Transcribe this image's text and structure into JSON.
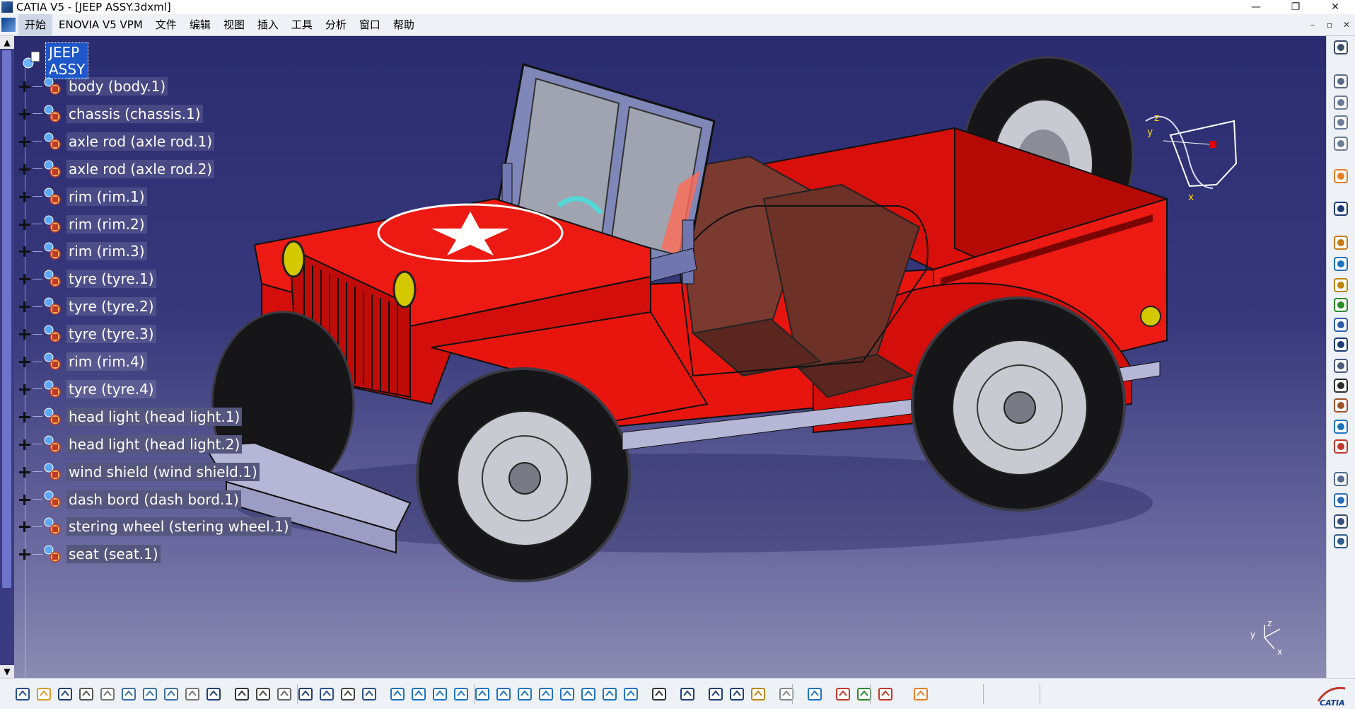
{
  "window": {
    "title": "CATIA V5 - [JEEP ASSY.3dxml]",
    "minimize_glyph": "—",
    "restore_glyph": "❐",
    "close_glyph": "✕"
  },
  "menu": {
    "items": [
      "开始",
      "ENOVIA V5 VPM",
      "文件",
      "编辑",
      "视图",
      "插入",
      "工具",
      "分析",
      "窗口",
      "帮助"
    ],
    "active_index": 0,
    "mdi_min": "–",
    "mdi_restore": "▫",
    "mdi_close": "✕"
  },
  "tree": {
    "root_label": "JEEP ASSY",
    "items": [
      "body (body.1)",
      "chassis (chassis.1)",
      "axle rod (axle rod.1)",
      "axle rod (axle rod.2)",
      "rim (rim.1)",
      "rim (rim.2)",
      "rim (rim.3)",
      "tyre (tyre.1)",
      "tyre (tyre.2)",
      "tyre (tyre.3)",
      "rim (rim.4)",
      "tyre (tyre.4)",
      "head light (head light.1)",
      "head light (head light.2)",
      "wind shield (wind shield.1)",
      "dash bord (dash bord.1)",
      "stering wheel (stering wheel.1)",
      "seat (seat.1)"
    ]
  },
  "compass": {
    "x_label": "x",
    "y_label": "y",
    "z_label": "z"
  },
  "axis_triad": {
    "x_label": "x",
    "y_label": "y",
    "z_label": "z"
  },
  "brand": {
    "logo_text": "CATIA"
  },
  "colors": {
    "viewport_top": "#2b2c70",
    "viewport_bottom": "#8c8bb2",
    "jeep_body": "#e8150f",
    "tyre": "#161618",
    "seat": "#7a3a30",
    "selection": "#1d57c9"
  },
  "icons": {
    "right_toolbar": [
      "multi-view-icon",
      "product-icon",
      "part-icon",
      "catalog-icon",
      "analysis-icon",
      "select-arrow-icon",
      "snap-icon",
      "bolt-icon",
      "replace-icon",
      "gear-component-icon",
      "export-icon",
      "move-icon",
      "cross-icon",
      "bom-icon",
      "text-icon",
      "publish-icon",
      "clash-icon",
      "bolt-red-icon",
      "exploded-icon",
      "sectioning-icon",
      "distance-icon",
      "measure-icon"
    ],
    "bottom_toolbar": [
      "new-icon",
      "open-icon",
      "save-icon",
      "print-icon",
      "cut-icon",
      "copy-icon",
      "paste-icon",
      "undo-icon",
      "redo-icon",
      "whats-this-icon",
      "formula-icon",
      "knowledge-icon",
      "sort-icon",
      "table-icon",
      "tree-icon",
      "compile-icon",
      "rename-icon",
      "fly-icon",
      "fit-all-icon",
      "pan-icon",
      "rotate-icon",
      "zoom-in-icon",
      "zoom-out-icon",
      "normal-view-icon",
      "multi-view-icon",
      "iso-view-icon",
      "render-style-icon",
      "hide-show-icon",
      "swap-icon",
      "capture-icon",
      "update-icon",
      "distance-icon",
      "measure-item-icon",
      "inertia-icon",
      "refresh-icon",
      "eraser-icon",
      "material-icon",
      "texture-icon",
      "lighting-icon",
      "grid-icon"
    ]
  }
}
